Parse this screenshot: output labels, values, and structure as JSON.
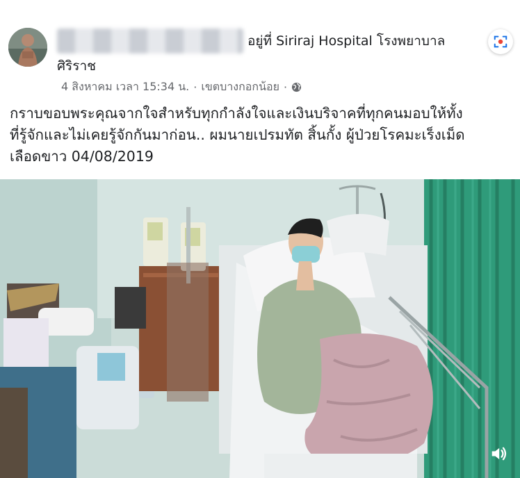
{
  "post": {
    "checkin_text": "อยู่ที่ Siriraj Hospital โรงพยาบาล",
    "checkin_text_line2": "ศิริราช",
    "date": "4 สิงหาคม เวลา 15:34 น.",
    "separator1": "·",
    "location": "เขตบางกอกน้อย",
    "separator2": "·",
    "privacy_icon": "globe-icon",
    "body_lines": [
      "กราบขอบพระคุณจากใจสำหรับทุกกำลังใจและเงินบริจาคที่ทุกคนมอบให้ทั้ง",
      "ที่รู้จักและไม่เคยรู้จักกันมาก่อน.. ผมนายเปรมทัต สิ้นกั้ง ผู้ป่วยโรคมะเร็งเม็ด",
      "เลือดขาว 04/08/2019"
    ]
  },
  "icons": {
    "lens": "visual-search-icon",
    "sound": "speaker-icon"
  },
  "colors": {
    "text_primary": "#1c1e21",
    "text_secondary": "#65676b",
    "curtain": "#2f9b7a",
    "wall": "#cfe0dc"
  }
}
